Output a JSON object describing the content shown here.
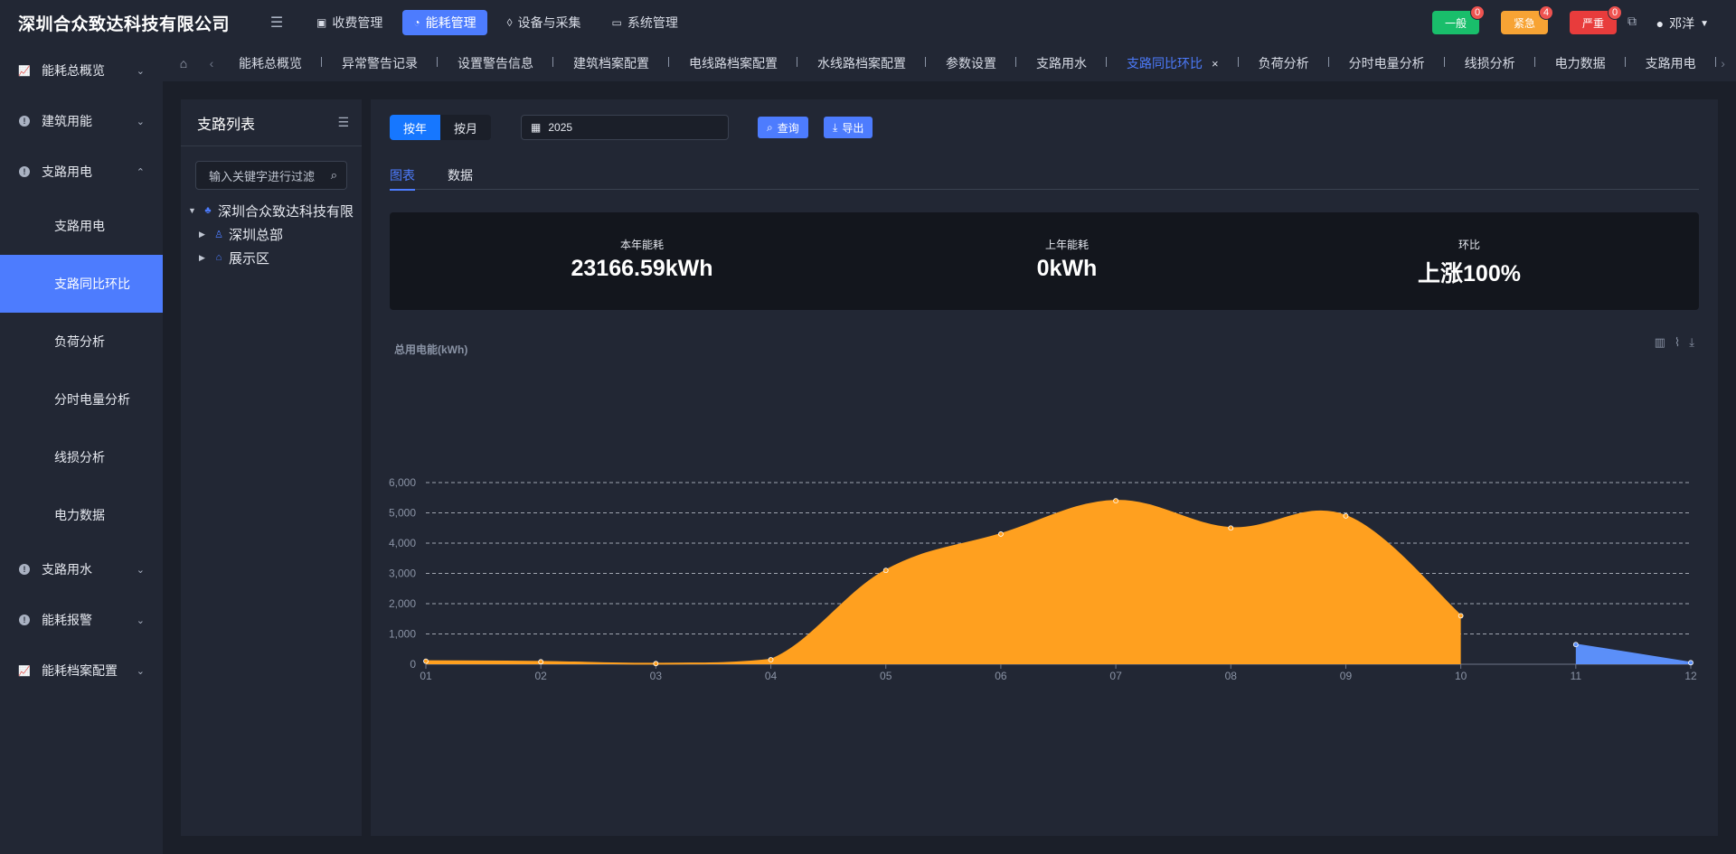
{
  "app": {
    "title": "深圳合众致达科技有限公司"
  },
  "topnav": [
    {
      "label": "收费管理",
      "icon": "calculator-icon",
      "active": false
    },
    {
      "label": "能耗管理",
      "icon": "gauge-icon",
      "active": true
    },
    {
      "label": "设备与采集",
      "icon": "drop-icon",
      "active": false
    },
    {
      "label": "系统管理",
      "icon": "monitor-icon",
      "active": false
    }
  ],
  "alerts": [
    {
      "label": "一般",
      "count": "0",
      "color": "#19be6b"
    },
    {
      "label": "紧急",
      "count": "4",
      "color": "#f7a334"
    },
    {
      "label": "严重",
      "count": "0",
      "color": "#e83c3c"
    }
  ],
  "user": {
    "name": "邓洋"
  },
  "sidebar": {
    "items": [
      {
        "label": "能耗总概览",
        "icon": "chart-icon"
      },
      {
        "label": "建筑用能",
        "icon": "info-icon"
      },
      {
        "label": "支路用电",
        "icon": "info-icon"
      },
      {
        "label": "支路用水",
        "icon": "info-icon"
      },
      {
        "label": "能耗报警",
        "icon": "info-icon"
      },
      {
        "label": "能耗档案配置",
        "icon": "chart-icon"
      }
    ],
    "subitems": [
      "支路用电",
      "支路同比环比",
      "负荷分析",
      "分时电量分析",
      "线损分析",
      "电力数据"
    ],
    "active_sub": "支路同比环比"
  },
  "tabs": [
    {
      "label": "能耗总概览"
    },
    {
      "label": "异常警告记录"
    },
    {
      "label": "设置警告信息"
    },
    {
      "label": "建筑档案配置"
    },
    {
      "label": "电线路档案配置"
    },
    {
      "label": "水线路档案配置"
    },
    {
      "label": "参数设置"
    },
    {
      "label": "支路用水"
    },
    {
      "label": "支路同比环比",
      "active": true
    },
    {
      "label": "负荷分析"
    },
    {
      "label": "分时电量分析"
    },
    {
      "label": "线损分析"
    },
    {
      "label": "电力数据"
    },
    {
      "label": "支路用电"
    }
  ],
  "left_panel": {
    "title": "支路列表",
    "filter_placeholder": "输入关键字进行过滤",
    "tree": [
      {
        "label": "深圳合众致达科技有限",
        "level": 0,
        "expanded": true,
        "icon": "org-icon"
      },
      {
        "label": "深圳总部",
        "level": 1,
        "expanded": false,
        "icon": "person-icon"
      },
      {
        "label": "展示区",
        "level": 1,
        "expanded": false,
        "icon": "bank-icon"
      }
    ]
  },
  "controls": {
    "period_options": [
      "按年",
      "按月"
    ],
    "period_selected": "按年",
    "year": "2025",
    "query_label": "查询",
    "export_label": "导出"
  },
  "subtabs": [
    "图表",
    "数据"
  ],
  "stats": [
    {
      "label": "本年能耗",
      "value": "23166.59kWh"
    },
    {
      "label": "上年能耗",
      "value": "0kWh"
    },
    {
      "label": "环比",
      "value": "上涨100%"
    }
  ],
  "chart_data": {
    "type": "area",
    "title": "总用电能(kWh)",
    "categories": [
      "01",
      "02",
      "03",
      "04",
      "05",
      "06",
      "07",
      "08",
      "09",
      "10",
      "11",
      "12"
    ],
    "ylim": [
      0,
      6000
    ],
    "yticks": [
      "0",
      "1,000",
      "2,000",
      "3,000",
      "4,000",
      "5,000",
      "6,000"
    ],
    "series": [
      {
        "values": [
          100,
          80,
          20,
          150,
          3100,
          4300,
          5400,
          4500,
          4900,
          1600,
          null,
          null
        ],
        "color": "#ffa01f"
      },
      {
        "values": [
          null,
          null,
          null,
          null,
          null,
          null,
          null,
          null,
          null,
          null,
          650,
          50
        ],
        "color": "#5b8ff9"
      }
    ],
    "grid": true
  }
}
